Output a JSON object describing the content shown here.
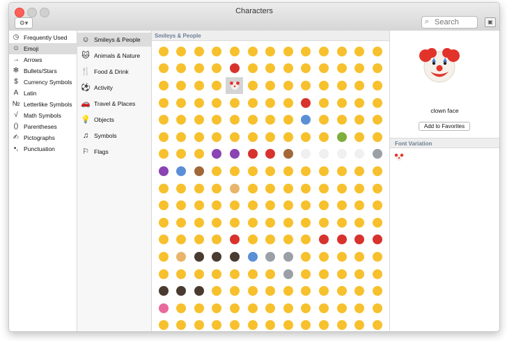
{
  "window": {
    "title": "Characters"
  },
  "toolbar": {
    "gear_label": "⚙▾",
    "search_placeholder": "Search"
  },
  "sidebar": {
    "items": [
      {
        "label": "Frequently Used",
        "icon": "clock-icon",
        "glyph": "◷",
        "selected": false
      },
      {
        "label": "Emoji",
        "icon": "smiley-icon",
        "glyph": "☺",
        "selected": true
      },
      {
        "label": "Arrows",
        "icon": "arrow-icon",
        "glyph": "→",
        "selected": false
      },
      {
        "label": "Bullets/Stars",
        "icon": "asterisk-icon",
        "glyph": "✻",
        "selected": false
      },
      {
        "label": "Currency Symbols",
        "icon": "dollar-icon",
        "glyph": "$",
        "selected": false
      },
      {
        "label": "Latin",
        "icon": "letter-a-icon",
        "glyph": "A",
        "selected": false
      },
      {
        "label": "Letterlike Symbols",
        "icon": "numero-icon",
        "glyph": "№",
        "selected": false
      },
      {
        "label": "Math Symbols",
        "icon": "sqrt-icon",
        "glyph": "√",
        "selected": false
      },
      {
        "label": "Parentheses",
        "icon": "paren-icon",
        "glyph": "()",
        "selected": false
      },
      {
        "label": "Pictographs",
        "icon": "pictograph-icon",
        "glyph": "✍",
        "selected": false
      },
      {
        "label": "Punctuation",
        "icon": "punctuation-icon",
        "glyph": "•,",
        "selected": false
      }
    ]
  },
  "categories": {
    "items": [
      {
        "label": "Smileys & People",
        "icon": "smiley-icon",
        "glyph": "☺",
        "selected": true
      },
      {
        "label": "Animals & Nature",
        "icon": "animal-icon",
        "glyph": "🐱",
        "selected": false
      },
      {
        "label": "Food & Drink",
        "icon": "food-icon",
        "glyph": "🍴",
        "selected": false
      },
      {
        "label": "Activity",
        "icon": "ball-icon",
        "glyph": "⚽",
        "selected": false
      },
      {
        "label": "Travel & Places",
        "icon": "car-icon",
        "glyph": "🚗",
        "selected": false
      },
      {
        "label": "Objects",
        "icon": "bulb-icon",
        "glyph": "💡",
        "selected": false
      },
      {
        "label": "Symbols",
        "icon": "symbols-icon",
        "glyph": "♫",
        "selected": false
      },
      {
        "label": "Flags",
        "icon": "flag-icon",
        "glyph": "⚐",
        "selected": false
      }
    ]
  },
  "grid": {
    "section_title": "Smileys & People",
    "columns": 13,
    "rows": 17,
    "selected_cell": {
      "row": 2,
      "col": 4
    },
    "colors": {
      "face": "#f7c02d",
      "face_alt": "#f2b025",
      "red": "#d8322c",
      "purple": "#8a44b3",
      "blue": "#5a8fd6",
      "grey": "#9aa0a6",
      "green": "#7fae3a",
      "white": "#f0f0f0",
      "skin": "#e8b56a",
      "dark": "#4a3b30",
      "pink": "#e86a9c",
      "brown": "#a2683a"
    },
    "row_colors": [
      [
        "face",
        "face",
        "face",
        "face",
        "face",
        "face",
        "face",
        "face",
        "face",
        "face",
        "face",
        "face",
        "face"
      ],
      [
        "face",
        "face",
        "face",
        "face",
        "red",
        "face",
        "face",
        "face",
        "face",
        "face",
        "face",
        "face",
        "face"
      ],
      [
        "face",
        "face",
        "face",
        "face",
        "selected",
        "face",
        "face",
        "face",
        "face",
        "face",
        "face",
        "face",
        "face"
      ],
      [
        "face",
        "face",
        "face",
        "face",
        "face",
        "face",
        "face",
        "face",
        "red",
        "face",
        "face",
        "face",
        "face"
      ],
      [
        "face",
        "face",
        "face",
        "face",
        "face",
        "face",
        "face",
        "face",
        "blue",
        "face",
        "face",
        "face",
        "face"
      ],
      [
        "face",
        "face",
        "face",
        "face",
        "face",
        "face",
        "face",
        "face",
        "face",
        "face",
        "green",
        "face",
        "face"
      ],
      [
        "face",
        "face",
        "face",
        "purple",
        "purple",
        "red",
        "red",
        "brown",
        "white",
        "white",
        "white",
        "white",
        "grey"
      ],
      [
        "purple",
        "blue",
        "brown",
        "face",
        "face",
        "face",
        "face",
        "face",
        "face",
        "face",
        "face",
        "face",
        "face"
      ],
      [
        "face",
        "face",
        "face",
        "face",
        "skin",
        "face",
        "face",
        "face",
        "face",
        "face",
        "face",
        "face",
        "face"
      ],
      [
        "face",
        "face",
        "face",
        "face",
        "face",
        "face",
        "face",
        "face",
        "face",
        "face",
        "face",
        "face",
        "face"
      ],
      [
        "face",
        "face",
        "face",
        "face",
        "face",
        "face",
        "face",
        "face",
        "face",
        "face",
        "face",
        "face",
        "face"
      ],
      [
        "face",
        "face",
        "face",
        "face",
        "red",
        "face",
        "face",
        "face",
        "face",
        "red",
        "red",
        "red",
        "red"
      ],
      [
        "face",
        "skin",
        "dark",
        "dark",
        "dark",
        "blue",
        "grey",
        "grey",
        "face",
        "face",
        "face",
        "face",
        "face"
      ],
      [
        "face",
        "face",
        "face",
        "face",
        "face",
        "face",
        "face",
        "grey",
        "face",
        "face",
        "face",
        "face",
        "face"
      ],
      [
        "dark",
        "dark",
        "dark",
        "face",
        "face",
        "face",
        "face",
        "face",
        "face",
        "face",
        "face",
        "face",
        "face"
      ],
      [
        "pink",
        "face",
        "face",
        "face",
        "face",
        "face",
        "face",
        "face",
        "face",
        "face",
        "face",
        "face",
        "face"
      ],
      [
        "face",
        "face",
        "face",
        "face",
        "face",
        "face",
        "face",
        "face",
        "face",
        "face",
        "face",
        "face",
        "face"
      ]
    ]
  },
  "detail": {
    "name": "clown face",
    "favorite_label": "Add to Favorites",
    "variation_title": "Font Variation"
  }
}
